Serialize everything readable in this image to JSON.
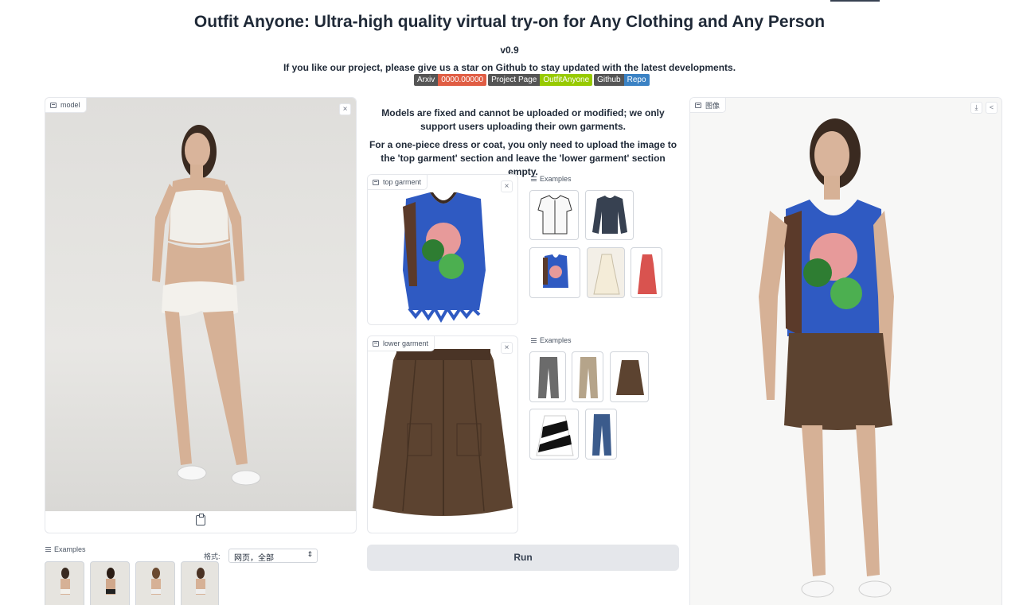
{
  "header": {
    "title": "Outfit Anyone: Ultra-high quality virtual try-on for Any Clothing and Any Person",
    "version": "v0.9",
    "notice": "If you like our project, please give us a star on Github to stay updated with the latest developments."
  },
  "badges": [
    {
      "left": "Arxiv",
      "right": "0000.00000",
      "color": "#e05d44"
    },
    {
      "left": "Project Page",
      "right": "OutfitAnyone",
      "color": "#97ca00"
    },
    {
      "left": "Github",
      "right": "Repo",
      "color": "#3b82c4"
    }
  ],
  "model_panel": {
    "label": "model",
    "examples_label": "Examples",
    "format_label": "格式:",
    "format_value": "网页，全部"
  },
  "center": {
    "info1": "Models are fixed and cannot be uploaded or modified; we only support users uploading their own garments.",
    "info2": "For a one-piece dress or coat, you only need to upload the image to the 'top garment' section and leave the 'lower garment' section empty.",
    "top_label": "top garment",
    "lower_label": "lower garment",
    "examples_label_top": "Examples",
    "examples_label_lower": "Examples",
    "run_label": "Run"
  },
  "output_panel": {
    "label": "图像"
  },
  "icons": {
    "close": "×",
    "download": "⤓",
    "share": "<"
  }
}
